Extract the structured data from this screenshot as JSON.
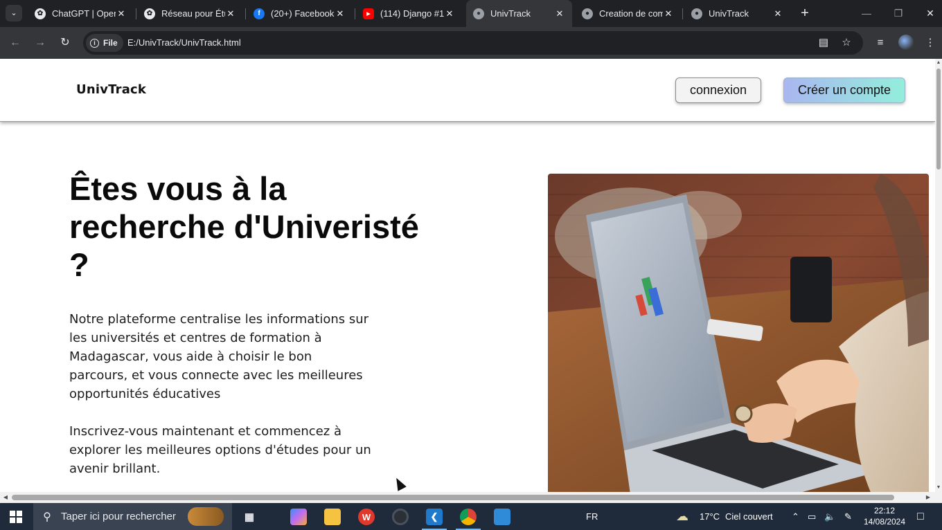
{
  "browser": {
    "tabs": [
      {
        "title": "ChatGPT | OpenAI",
        "favicon": "openai-icon",
        "active": false
      },
      {
        "title": "Réseau pour Étudiants",
        "favicon": "openai-icon",
        "active": false
      },
      {
        "title": "(20+) Facebook",
        "favicon": "facebook-icon",
        "active": false
      },
      {
        "title": "(114) Django #1",
        "favicon": "youtube-icon",
        "active": false
      },
      {
        "title": "UnivTrack",
        "favicon": "globe-icon",
        "active": true
      },
      {
        "title": "Creation de compte",
        "favicon": "globe-icon",
        "active": false
      },
      {
        "title": "UnivTrack",
        "favicon": "globe-icon",
        "active": false
      }
    ],
    "address": {
      "chip_label": "File",
      "url": "E:/UnivTrack/UnivTrack.html"
    }
  },
  "page": {
    "header": {
      "logo": "UnivTrack",
      "login_label": "connexion",
      "signup_label": "Créer un compte"
    },
    "hero": {
      "title": "Êtes vous à la recherche d'Univeristé ?",
      "paragraph1": "Notre plateforme centralise les informations sur les universités et centres de formation à Madagascar, vous aide à choisir le bon parcours, et vous connecte avec les meilleures opportunités éducatives",
      "paragraph2": "Inscrivez-vous maintenant et commencez à explorer les meilleures options d'études pour un avenir brillant."
    },
    "colors": {
      "signup_gradient_start": "#aab6f0",
      "signup_gradient_end": "#93eedc"
    }
  },
  "taskbar": {
    "search_placeholder": "Taper ici pour rechercher",
    "language": "FR",
    "weather": {
      "temperature": "17°C",
      "condition": "Ciel couvert"
    },
    "time": "22:12",
    "date": "14/08/2024"
  }
}
